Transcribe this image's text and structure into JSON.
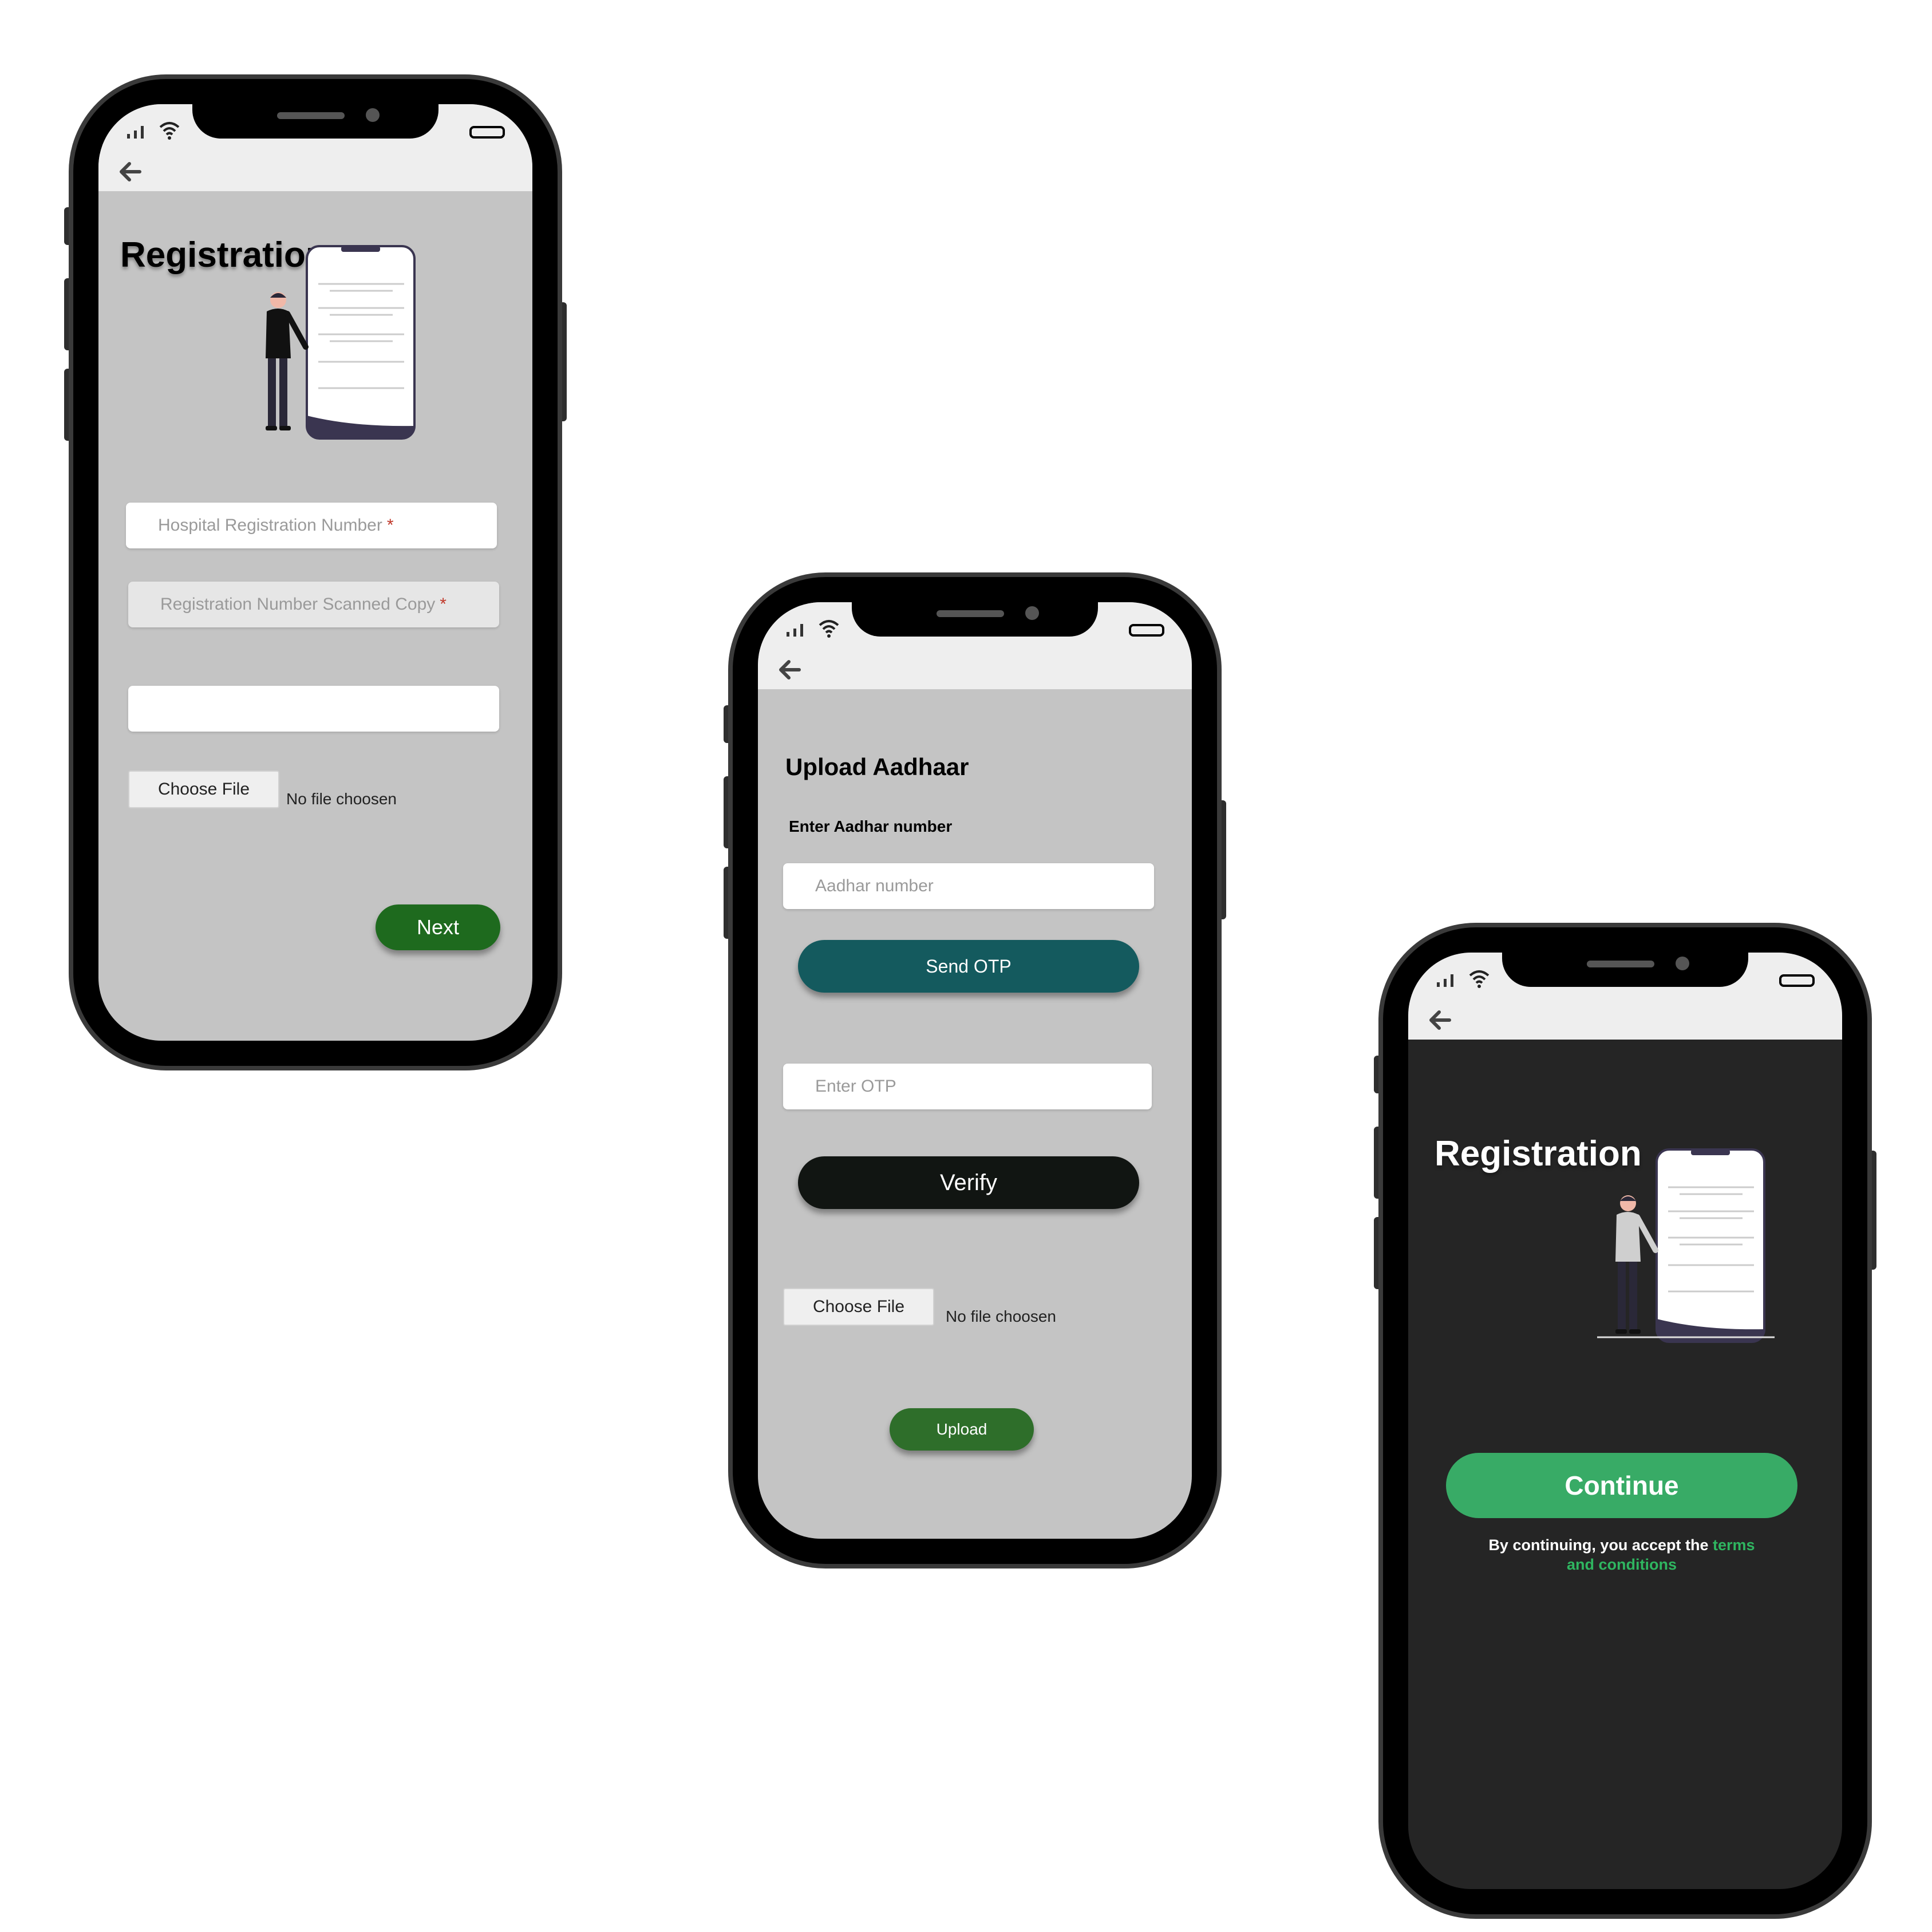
{
  "screens": [
    {
      "id": "hospital-registration",
      "title": "Registration",
      "fields": [
        {
          "placeholder": "Hospital Registration Number",
          "required_mark": "*"
        },
        {
          "placeholder": "Registration Number Scanned Copy",
          "required_mark": "*"
        },
        {
          "placeholder": ""
        }
      ],
      "choose_file_label": "Choose File",
      "no_file_text": "No file choosen",
      "next_label": "Next"
    },
    {
      "id": "upload-aadhaar",
      "title": "Upload Aadhaar",
      "aadhar_label": "Enter Aadhar number",
      "aadhar_placeholder": "Aadhar number",
      "send_otp_label": "Send OTP",
      "otp_placeholder": "Enter OTP",
      "verify_label": "Verify",
      "choose_file_label": "Choose File",
      "no_file_text": "No file choosen",
      "upload_label": "Upload"
    },
    {
      "id": "registration-dark",
      "title": "Registration",
      "continue_label": "Continue",
      "terms_prefix": "By continuing, you accept the",
      "terms_link_1": "terms",
      "terms_link_2": "and conditions"
    }
  ],
  "colors": {
    "next_button": "#1e6a1e",
    "send_otp_button": "#145a5e",
    "verify_button": "#111512",
    "upload_button": "#2e6e2a",
    "continue_button": "#38ab66",
    "screen_light_bg": "#c4c4c4",
    "screen_dark_bg": "#252525",
    "terms_highlight": "#2fb560"
  },
  "icons": [
    "signal-icon",
    "wifi-icon",
    "battery-icon",
    "back-arrow-icon",
    "registration-illustration"
  ]
}
